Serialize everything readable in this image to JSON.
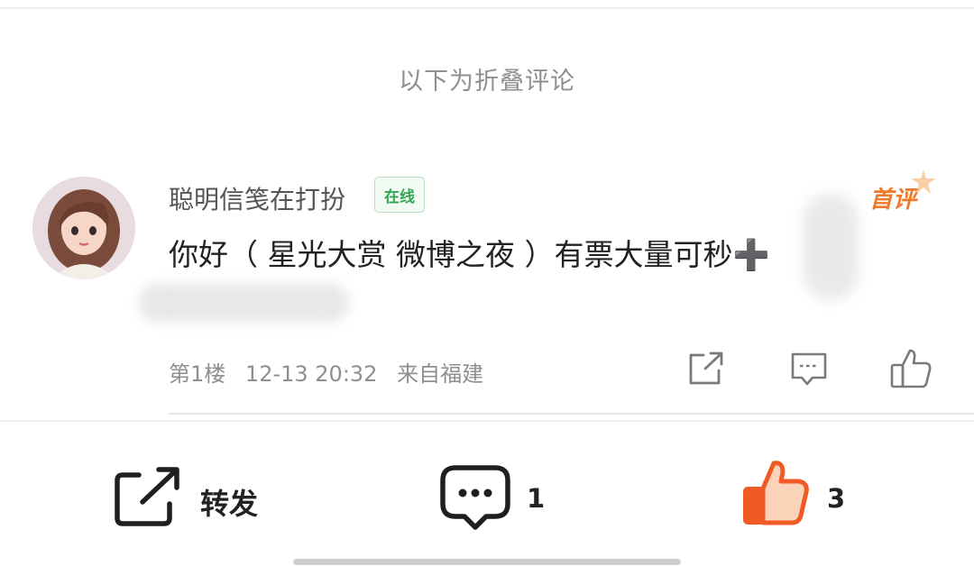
{
  "fold_notice": "以下为折叠评论",
  "comment": {
    "username": "聪明信笺在打扮",
    "online_badge": "在线",
    "first_comment_badge": "首评",
    "text": "你好（ 星光大赏 微博之夜 ）有票大量可秒➕",
    "floor": "第1楼",
    "time": "12-13 20:32",
    "location": "来自福建"
  },
  "bottom_bar": {
    "forward_label": "转发",
    "comment_count": "1",
    "like_count": "3"
  },
  "colors": {
    "accent_orange": "#f05a24",
    "online_green": "#37a654",
    "meta_gray": "#8f8f8f"
  },
  "icons": [
    "share-icon",
    "reply-icon",
    "thumbs-up-icon",
    "forward-icon",
    "comment-bubble-icon",
    "thumbs-up-filled-icon"
  ]
}
